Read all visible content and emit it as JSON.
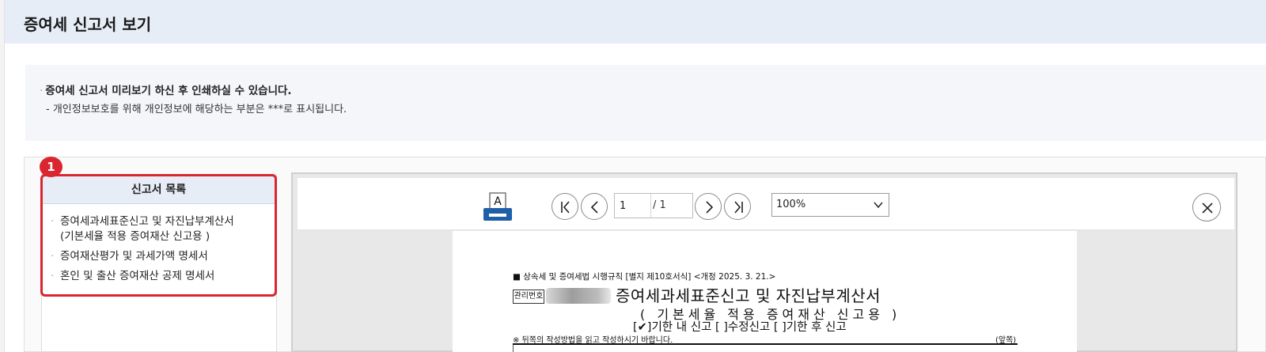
{
  "page": {
    "title": "증여세 신고서 보기"
  },
  "notice": {
    "main": "증여세 신고서 미리보기 하신 후 인쇄하실 수 있습니다.",
    "bullet": "·",
    "sub": "- 개인정보보호를 위해 개인정보에 해당하는 부분은  ***로 표시됩니다."
  },
  "step_badge": "1",
  "report_list": {
    "header": "신고서 목록",
    "items": [
      {
        "label": "증여세과세표준신고 및 자진납부계산서",
        "sublabel": "(기본세율 적용 증여재산 신고용 )"
      },
      {
        "label": "증여재산평가 및 과세가액 명세서",
        "sublabel": ""
      },
      {
        "label": "혼인 및 출산 증여재산 공제 명세서",
        "sublabel": ""
      }
    ]
  },
  "viewer": {
    "print_letter": "A",
    "current_page": "1",
    "total_pages": "/ 1",
    "zoom": "100%",
    "colors": {
      "print_icon": "#1f5fa8",
      "highlight": "#d9262f",
      "header_bg": "#e6edf7"
    }
  },
  "document": {
    "law_reference": "■ 상속세 및 증여세법 시행규칙 [별지 제10호서식] <개정 2025. 3. 21.>",
    "mgmt_label": "관리번호",
    "title": "증여세과세표준신고 및 자진납부계산서",
    "subtitle": "( 기본세율 적용 증여재산 신고용 )",
    "filing_type": "[✔]기한 내 신고 [  ]수정신고 [  ]기한 후 신고",
    "note": "※ 뒤쪽의 작성방법을 읽고 작성하시기 바랍니다.",
    "side": "(앞쪽)"
  }
}
